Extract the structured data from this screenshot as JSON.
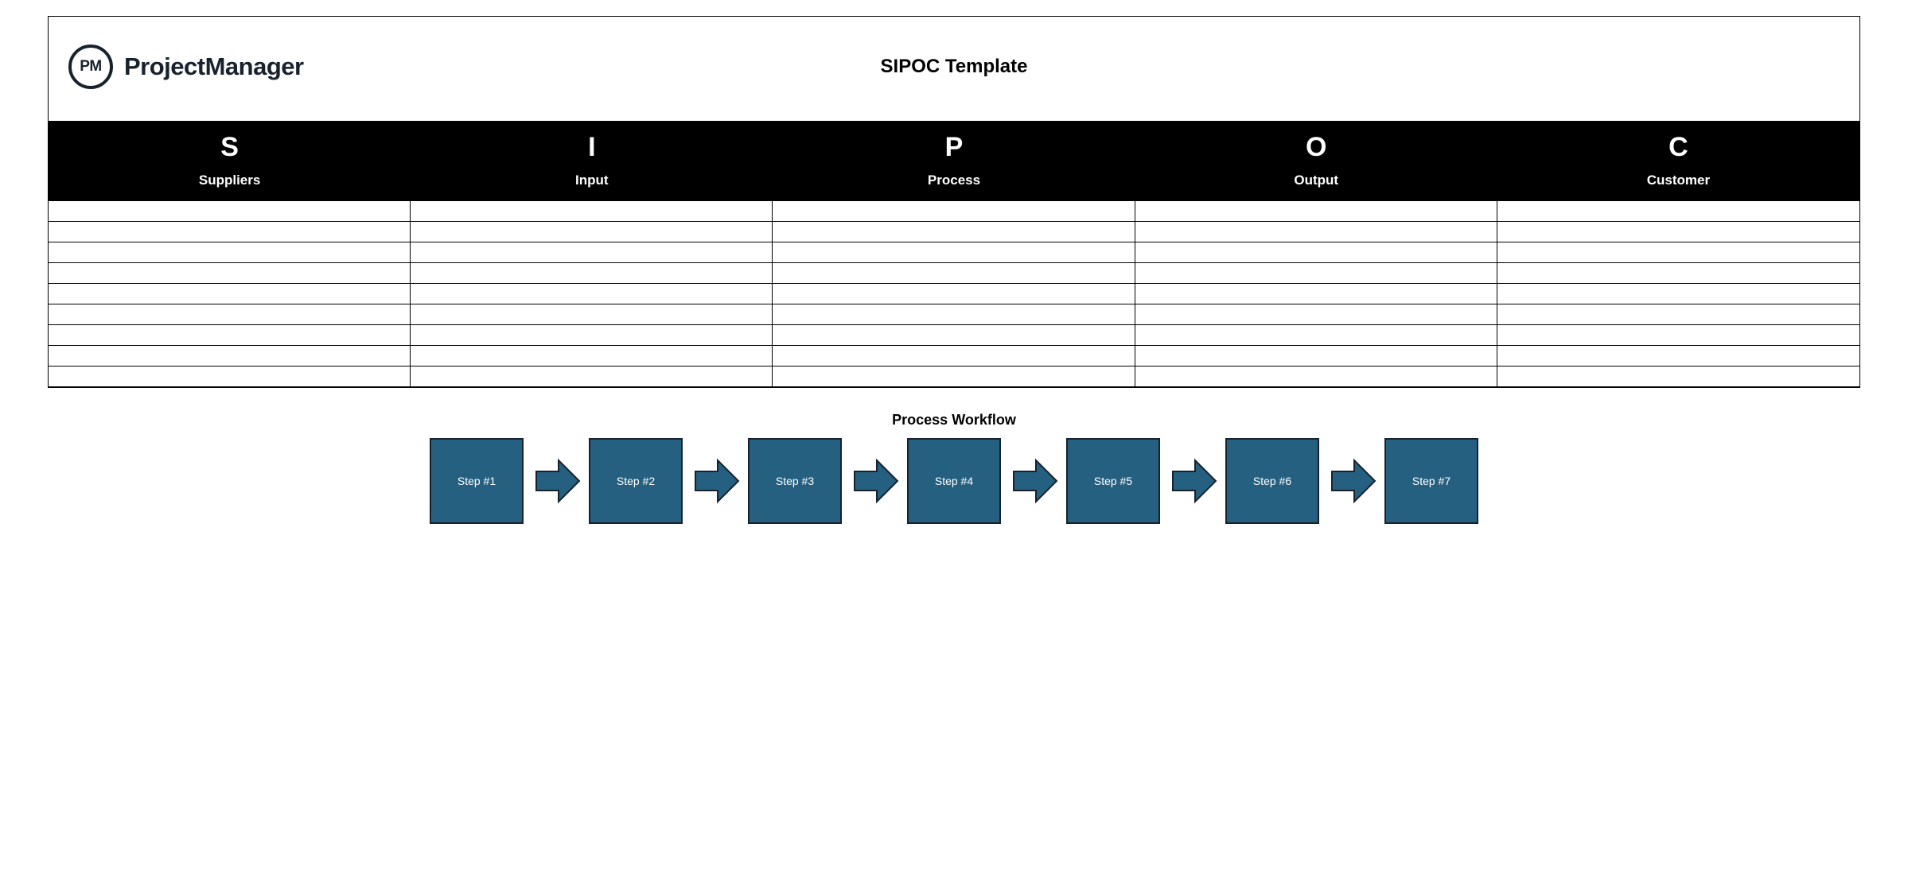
{
  "brand": {
    "logo_text": "PM",
    "name": "ProjectManager"
  },
  "title": "SIPOC Template",
  "columns": [
    {
      "letter": "S",
      "label": "Suppliers"
    },
    {
      "letter": "I",
      "label": "Input"
    },
    {
      "letter": "P",
      "label": "Process"
    },
    {
      "letter": "O",
      "label": "Output"
    },
    {
      "letter": "C",
      "label": "Customer"
    }
  ],
  "rows": [
    [
      "",
      "",
      "",
      "",
      ""
    ],
    [
      "",
      "",
      "",
      "",
      ""
    ],
    [
      "",
      "",
      "",
      "",
      ""
    ],
    [
      "",
      "",
      "",
      "",
      ""
    ],
    [
      "",
      "",
      "",
      "",
      ""
    ],
    [
      "",
      "",
      "",
      "",
      ""
    ],
    [
      "",
      "",
      "",
      "",
      ""
    ],
    [
      "",
      "",
      "",
      "",
      ""
    ],
    [
      "",
      "",
      "",
      "",
      ""
    ]
  ],
  "workflow": {
    "title": "Process Workflow",
    "steps": [
      "Step #1",
      "Step #2",
      "Step #3",
      "Step #4",
      "Step #5",
      "Step #6",
      "Step #7"
    ]
  },
  "colors": {
    "step_fill": "#256080",
    "step_border": "#17222e"
  }
}
